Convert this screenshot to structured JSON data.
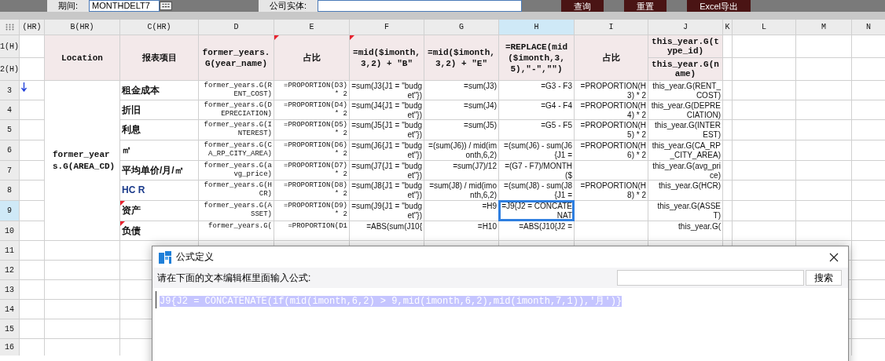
{
  "toolbar": {
    "fields": [
      {
        "label": "期间:",
        "value": "MONTHDELT7"
      },
      {
        "label": "公司实体:"
      }
    ],
    "buttons": [
      "查询",
      "重置",
      "Excel导出"
    ]
  },
  "sheet": {
    "columns": [
      {
        "label": "(HR)",
        "selected": false
      },
      {
        "label": "B(HR)",
        "selected": false
      },
      {
        "label": "C(HR)",
        "selected": false
      },
      {
        "label": "D",
        "selected": false
      },
      {
        "label": "E",
        "selected": false
      },
      {
        "label": "F",
        "selected": false
      },
      {
        "label": "G",
        "selected": false
      },
      {
        "label": "H",
        "selected": true
      },
      {
        "label": "I",
        "selected": false
      },
      {
        "label": "J",
        "selected": false
      },
      {
        "label": "K",
        "selected": false
      },
      {
        "label": "L",
        "selected": false
      },
      {
        "label": "M",
        "selected": false
      },
      {
        "label": "N",
        "selected": false
      }
    ],
    "rows": [
      {
        "label": "1(H)",
        "selected": false,
        "cells": [
          null,
          {
            "kind": "header",
            "text": "Location",
            "flag": false,
            "selected": false
          },
          {
            "kind": "header",
            "text": "报表项目",
            "flag": false,
            "selected": false
          },
          {
            "kind": "header",
            "text": "former_years.G(year_name)",
            "flag": false,
            "selected": false
          },
          {
            "kind": "header",
            "text": "占比",
            "flag": true,
            "selected": false
          },
          {
            "kind": "header",
            "text": "=mid($imonth,3,2) + \"B\"",
            "flag": true,
            "selected": false
          },
          {
            "kind": "header",
            "text": "=mid($imonth,3,2) + \"E\"",
            "flag": false,
            "selected": false
          },
          {
            "kind": "header",
            "text": "=REPLACE(mid($imonth,3,5),\"-\",\"\")",
            "flag": false,
            "selected": false
          },
          {
            "kind": "header",
            "text": "占比",
            "flag": false,
            "selected": false
          },
          {
            "kind": "subheader",
            "text": "this_year.G(type_id)",
            "flag": false,
            "selected": false
          }
        ]
      },
      {
        "label": "2(H)",
        "selected": false,
        "cells": [
          null,
          null,
          null,
          null,
          null,
          null,
          null,
          null,
          null,
          {
            "kind": "subheader",
            "text": "this_year.G(name)",
            "flag": false,
            "selected": false
          }
        ]
      },
      {
        "label": "3",
        "selected": false,
        "cells": [
          null,
          {
            "kind": "group",
            "text": "former_years.G(AREA_CD)",
            "flag": false,
            "selected": false
          },
          {
            "kind": "label",
            "text": "租金成本",
            "flag": false,
            "selected": false
          },
          {
            "kind": "mono",
            "text": "former_years.G(RENT_COST)",
            "flag": false,
            "selected": false
          },
          {
            "kind": "mono",
            "text": "=PROPORTION(D3) * 2",
            "flag": false,
            "selected": false
          },
          {
            "kind": "formula",
            "text": "=sum(J3{J1 = \"budget\"})",
            "flag": false,
            "selected": false
          },
          {
            "kind": "formula",
            "text": "=sum(J3)",
            "flag": false,
            "selected": false
          },
          {
            "kind": "formula",
            "text": "=G3 - F3",
            "flag": false,
            "selected": false
          },
          {
            "kind": "formula",
            "text": "=PROPORTION(H3) * 2",
            "flag": false,
            "selected": false
          },
          {
            "kind": "formula",
            "text": "this_year.G(RENT_COST)",
            "flag": false,
            "selected": false
          }
        ]
      },
      {
        "label": "4",
        "selected": false,
        "cells": [
          null,
          null,
          {
            "kind": "label",
            "text": "折旧",
            "flag": false,
            "selected": false
          },
          {
            "kind": "mono",
            "text": "former_years.G(DEPRECIATION)",
            "flag": false,
            "selected": false
          },
          {
            "kind": "mono",
            "text": "=PROPORTION(D4) * 2",
            "flag": false,
            "selected": false
          },
          {
            "kind": "formula",
            "text": "=sum(J4{J1 = \"budget\"})",
            "flag": false,
            "selected": false
          },
          {
            "kind": "formula",
            "text": "=sum(J4)",
            "flag": false,
            "selected": false
          },
          {
            "kind": "formula",
            "text": "=G4 - F4",
            "flag": false,
            "selected": false
          },
          {
            "kind": "formula",
            "text": "=PROPORTION(H4) * 2",
            "flag": false,
            "selected": false
          },
          {
            "kind": "formula",
            "text": "this_year.G(DEPRECIATION)",
            "flag": false,
            "selected": false
          }
        ]
      },
      {
        "label": "5",
        "selected": false,
        "cells": [
          null,
          null,
          {
            "kind": "label",
            "text": "利息",
            "flag": false,
            "selected": false
          },
          {
            "kind": "mono",
            "text": "former_years.G(INTEREST)",
            "flag": false,
            "selected": false
          },
          {
            "kind": "mono",
            "text": "=PROPORTION(D5) * 2",
            "flag": false,
            "selected": false
          },
          {
            "kind": "formula",
            "text": "=sum(J5{J1 = \"budget\"})",
            "flag": false,
            "selected": false
          },
          {
            "kind": "formula",
            "text": "=sum(J5)",
            "flag": false,
            "selected": false
          },
          {
            "kind": "formula",
            "text": "=G5 - F5",
            "flag": false,
            "selected": false
          },
          {
            "kind": "formula",
            "text": "=PROPORTION(H5) * 2",
            "flag": false,
            "selected": false
          },
          {
            "kind": "formula",
            "text": "this_year.G(INTEREST)",
            "flag": false,
            "selected": false
          }
        ]
      },
      {
        "label": "6",
        "selected": false,
        "cells": [
          null,
          null,
          {
            "kind": "label",
            "text": "㎡",
            "flag": false,
            "selected": false
          },
          {
            "kind": "mono",
            "text": "former_years.G(CA_RP_CITY_AREA)",
            "flag": false,
            "selected": false
          },
          {
            "kind": "mono",
            "text": "=PROPORTION(D6) * 2",
            "flag": false,
            "selected": false
          },
          {
            "kind": "formula",
            "text": "=sum(J6{J1 = \"budget\"})",
            "flag": false,
            "selected": false
          },
          {
            "kind": "formula",
            "text": "=(sum(J6)) / mid(imonth,6,2)",
            "flag": false,
            "selected": false
          },
          {
            "kind": "formula",
            "text": "=(sum(J6) - sum(J6{J1 =",
            "flag": false,
            "selected": false
          },
          {
            "kind": "formula",
            "text": "=PROPORTION(H6) * 2",
            "flag": false,
            "selected": false
          },
          {
            "kind": "formula",
            "text": "this_year.G(CA_RP_CITY_AREA)",
            "flag": false,
            "selected": false
          }
        ]
      },
      {
        "label": "7",
        "selected": false,
        "cells": [
          null,
          null,
          {
            "kind": "label",
            "text": "平均单价/月/㎡",
            "flag": false,
            "selected": false
          },
          {
            "kind": "mono",
            "text": "former_years.G(avg_price)",
            "flag": false,
            "selected": false
          },
          {
            "kind": "mono",
            "text": "=PROPORTION(D7) * 2",
            "flag": false,
            "selected": false
          },
          {
            "kind": "formula",
            "text": "=sum(J7{J1 = \"budget\"})",
            "flag": false,
            "selected": false
          },
          {
            "kind": "formula",
            "text": "=sum(J7)/12",
            "flag": false,
            "selected": false
          },
          {
            "kind": "formula",
            "text": "=(G7 - F7)/MONTH($",
            "flag": false,
            "selected": false
          },
          null,
          {
            "kind": "formula",
            "text": "this_year.G(avg_price)",
            "flag": false,
            "selected": false
          }
        ]
      },
      {
        "label": "8",
        "selected": false,
        "cells": [
          null,
          null,
          {
            "kind": "label",
            "text": "HC R",
            "flag": false,
            "selected": false
          },
          {
            "kind": "mono",
            "text": "former_years.G(HCR)",
            "flag": false,
            "selected": false
          },
          {
            "kind": "mono",
            "text": "=PROPORTION(D8) * 2",
            "flag": false,
            "selected": false
          },
          {
            "kind": "formula",
            "text": "=sum(J8{J1 = \"budget\"})",
            "flag": false,
            "selected": false
          },
          {
            "kind": "formula",
            "text": "=sum(J8) / mid(imonth,6,2)",
            "flag": false,
            "selected": false
          },
          {
            "kind": "formula",
            "text": "=(sum(J8) - sum(J8{J1 =",
            "flag": false,
            "selected": false
          },
          {
            "kind": "formula",
            "text": "=PROPORTION(H8) * 2",
            "flag": false,
            "selected": false
          },
          {
            "kind": "formula",
            "text": "this_year.G(HCR)",
            "flag": false,
            "selected": false
          }
        ]
      },
      {
        "label": "9",
        "selected": true,
        "cells": [
          null,
          null,
          {
            "kind": "label",
            "text": "资产",
            "flag": true,
            "selected": false
          },
          {
            "kind": "mono",
            "text": "former_years.G(ASSET)",
            "flag": false,
            "selected": false
          },
          {
            "kind": "mono",
            "text": "=PROPORTION(D9) * 2",
            "flag": false,
            "selected": false
          },
          {
            "kind": "formula",
            "text": "=sum(J9{J1 = \"budget\"})",
            "flag": false,
            "selected": false
          },
          {
            "kind": "formula",
            "text": "=H9",
            "flag": false,
            "selected": false
          },
          {
            "kind": "formula",
            "text": "=J9{J2 = CONCATENAT",
            "flag": false,
            "selected": true
          },
          null,
          {
            "kind": "formula",
            "text": "this_year.G(ASSET)",
            "flag": false,
            "selected": false
          }
        ]
      },
      {
        "label": "10",
        "selected": false,
        "cells": [
          null,
          null,
          {
            "kind": "label",
            "text": "负债",
            "flag": true,
            "selected": false
          },
          {
            "kind": "mono",
            "text": "former_years.G(",
            "flag": false,
            "selected": false
          },
          {
            "kind": "mono",
            "text": "=PROPORTION(D1",
            "flag": false,
            "selected": false
          },
          {
            "kind": "formula",
            "text": "=ABS(sum(J10{",
            "flag": false,
            "selected": false
          },
          {
            "kind": "formula",
            "text": "=H10",
            "flag": false,
            "selected": false
          },
          {
            "kind": "formula",
            "text": "=ABS(J10{J2 =",
            "flag": false,
            "selected": false
          },
          null,
          {
            "kind": "formula",
            "text": "this_year.G(",
            "flag": false,
            "selected": false
          }
        ]
      },
      {
        "label": "11",
        "selected": false
      },
      {
        "label": "12",
        "selected": false
      },
      {
        "label": "13",
        "selected": false
      },
      {
        "label": "14",
        "selected": false
      },
      {
        "label": "15",
        "selected": false
      },
      {
        "label": "16",
        "selected": false
      }
    ]
  },
  "dialog": {
    "title": "公式定义",
    "prompt": "请在下面的文本编辑框里面输入公式:",
    "search_button": "搜索",
    "formula": "J9{J2 = CONCATENATE(if(mid(imonth,6,2) > 9,mid(imonth,6,2),mid(imonth,7,1)),'月')}",
    "formula_selected": true
  }
}
